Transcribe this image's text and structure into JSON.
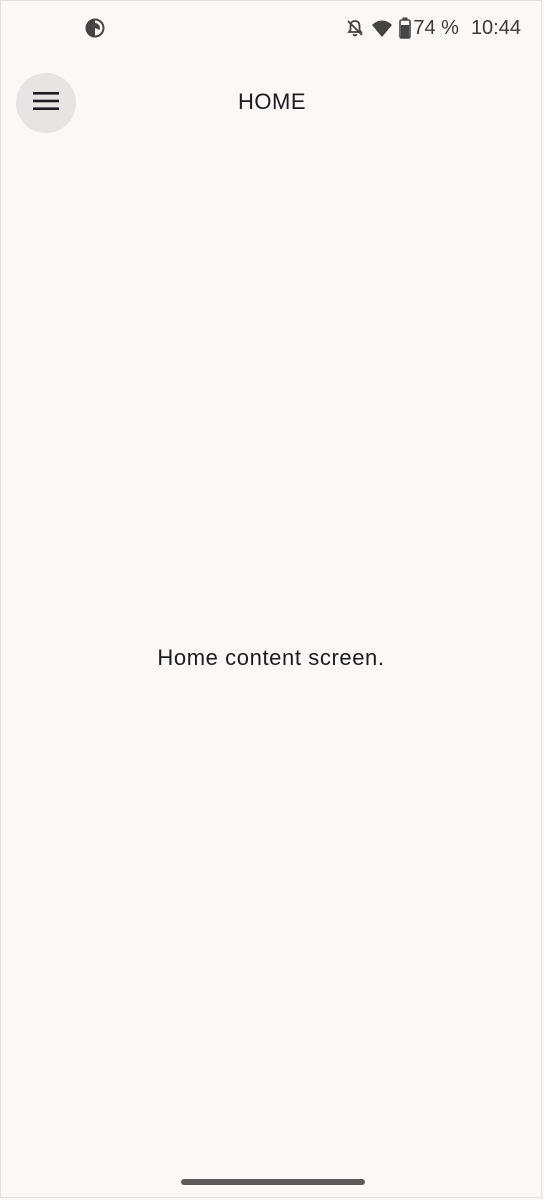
{
  "status_bar": {
    "left_icon": "data-saver-icon",
    "icons": [
      "notifications-off-icon",
      "wifi-icon",
      "battery-icon"
    ],
    "battery_text": "74 %",
    "time": "10:44"
  },
  "app_bar": {
    "menu_icon": "menu-icon",
    "title": "HOME"
  },
  "main": {
    "content_text": "Home content screen."
  },
  "colors": {
    "background": "#fdf8f8",
    "menu_button_bg": "#e8e4e4",
    "text": "#1c1b1f"
  }
}
